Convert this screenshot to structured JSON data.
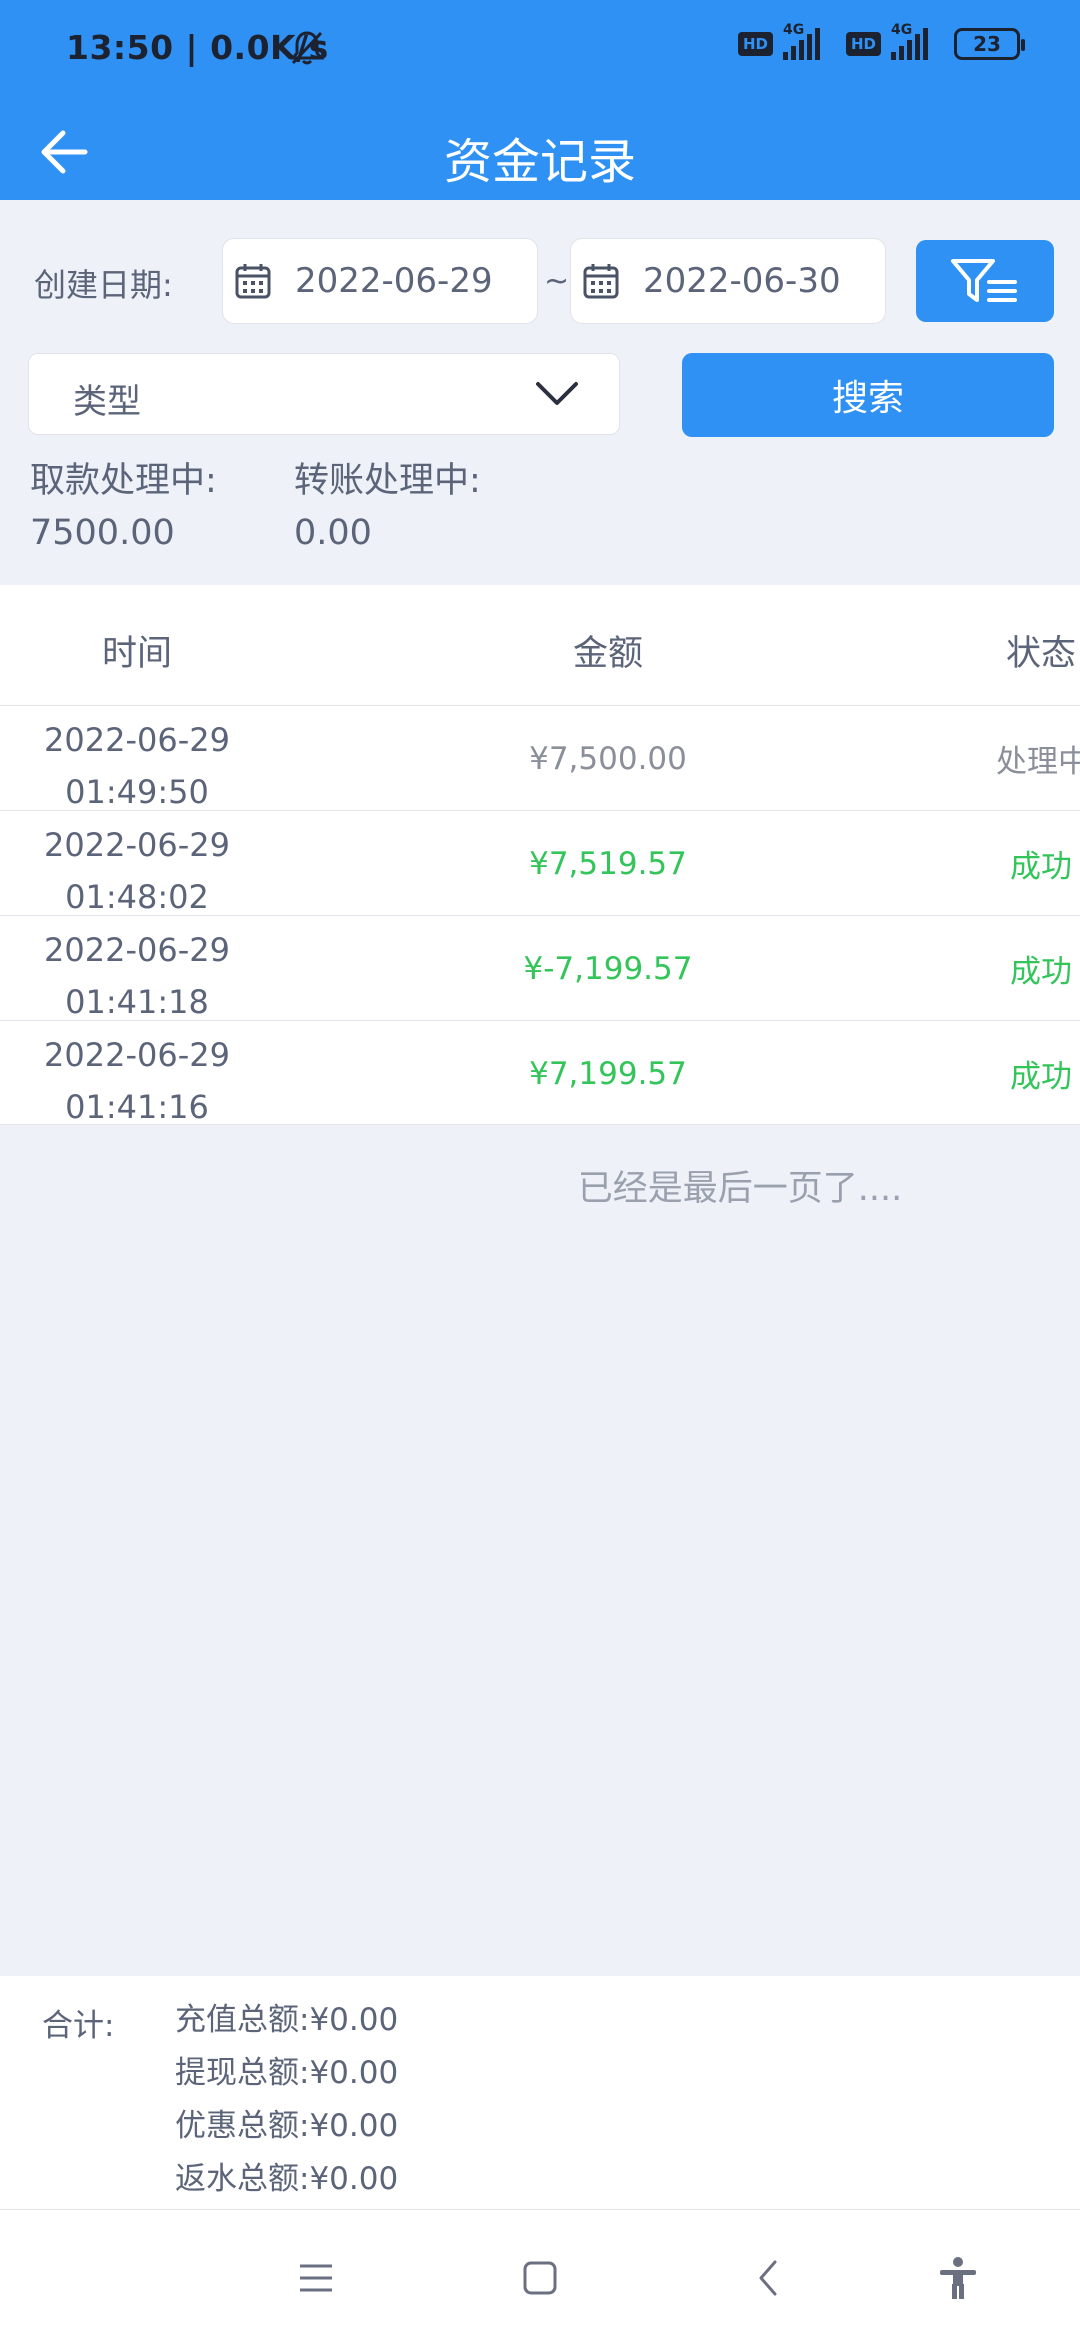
{
  "status_bar": {
    "time": "13:50 | 0.0K/s",
    "network_badges": [
      "HD",
      "HD"
    ],
    "network_types": [
      "4G",
      "4G"
    ],
    "battery": "23",
    "icons": [
      "mute-bell-icon",
      "signal-icon",
      "battery-icon"
    ]
  },
  "header": {
    "title": "资金记录",
    "back_icon": "arrow-left-icon"
  },
  "filter": {
    "date_label": "创建日期:",
    "date_start": "2022-06-29",
    "date_sep": "~",
    "date_end": "2022-06-30",
    "type_placeholder": "类型",
    "search_label": "搜索",
    "filter_icon": "filter-icon"
  },
  "pending": {
    "withdraw_label": "取款处理中:",
    "withdraw_value": "7500.00",
    "transfer_label": "转账处理中:",
    "transfer_value": "0.00"
  },
  "table": {
    "headers": [
      "时间",
      "金额",
      "状态"
    ],
    "rows": [
      {
        "date": "2022-06-29",
        "time": "01:49:50",
        "amount": "¥7,500.00",
        "status": "处理中"
      },
      {
        "date": "2022-06-29",
        "time": "01:48:02",
        "amount": "¥7,519.57",
        "status": "成功"
      },
      {
        "date": "2022-06-29",
        "time": "01:41:18",
        "amount": "¥-7,199.57",
        "status": "成功"
      },
      {
        "date": "2022-06-29",
        "time": "01:41:16",
        "amount": "¥7,199.57",
        "status": "成功"
      }
    ],
    "end_text": "已经是最后一页了...."
  },
  "totals": {
    "label": "合计:",
    "lines": [
      "充值总额:¥0.00",
      "提现总额:¥0.00",
      "优惠总额:¥0.00",
      "返水总额:¥0.00"
    ]
  },
  "colors": {
    "primary": "#2f91f4",
    "success": "#33c45a",
    "muted": "#8a8f99"
  }
}
